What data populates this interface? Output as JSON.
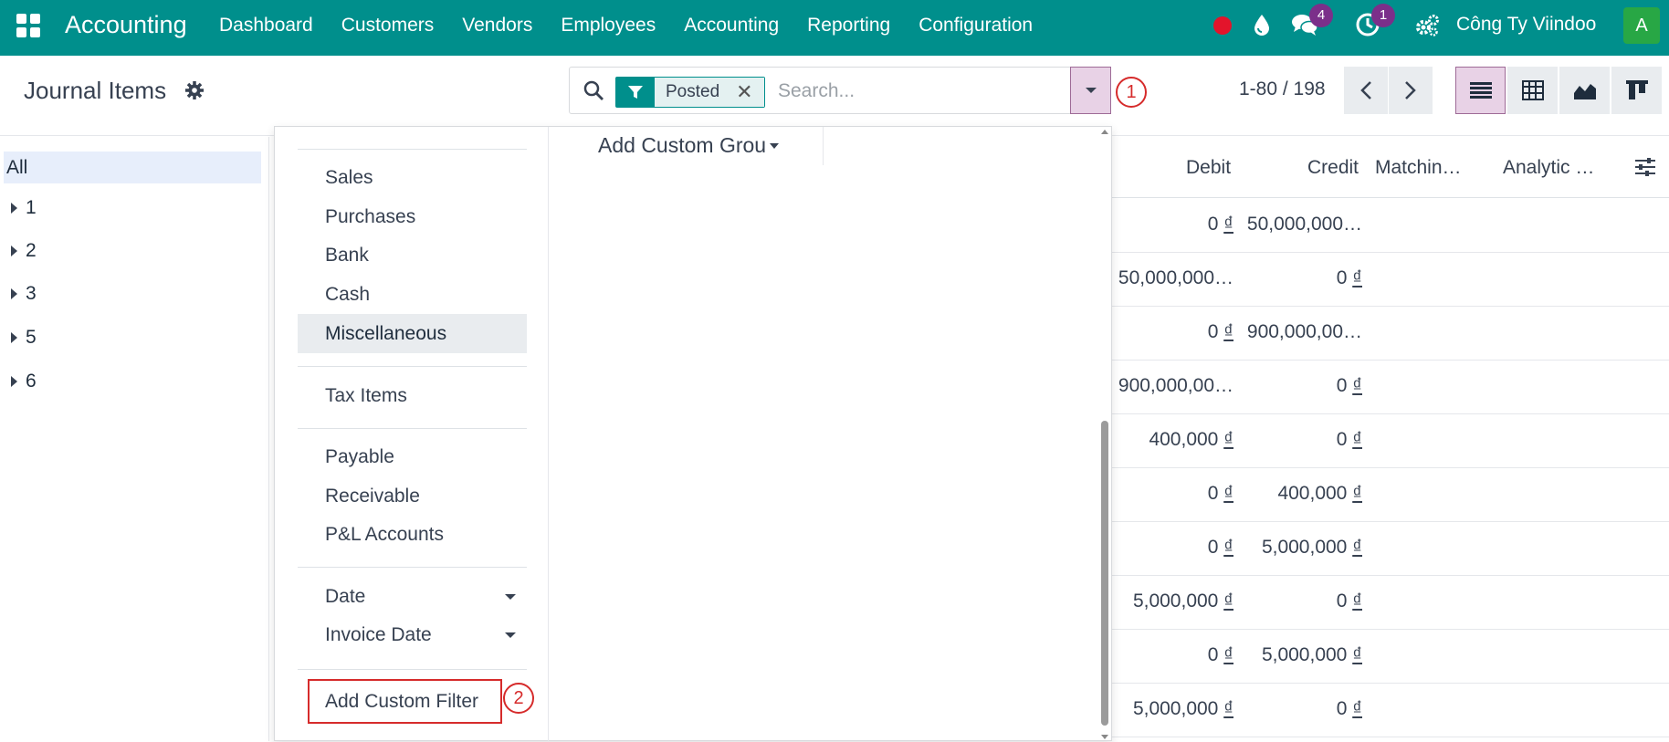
{
  "navbar": {
    "app_name": "Accounting",
    "menu": [
      "Dashboard",
      "Customers",
      "Vendors",
      "Employees",
      "Accounting",
      "Reporting",
      "Configuration"
    ],
    "messages_count": "4",
    "activities_count": "1",
    "company": "Công Ty Viindoo",
    "avatar_initial": "A",
    "colors": {
      "navbar_bg": "#008f8c",
      "badge": "#7b2f8a",
      "avatar": "#28a745",
      "record_dot": "#e3142b"
    }
  },
  "control_panel": {
    "title": "Journal Items",
    "search": {
      "facet_label": "Posted",
      "placeholder": "Search..."
    },
    "pager": "1-80 / 198",
    "callouts": {
      "toggle": "1",
      "add_filter": "2"
    }
  },
  "side_panel": {
    "all_label": "All",
    "items": [
      "1",
      "2",
      "3",
      "5",
      "6"
    ]
  },
  "filter_menu": {
    "journal_filters": [
      "Sales",
      "Purchases",
      "Bank",
      "Cash",
      "Miscellaneous"
    ],
    "active": "Miscellaneous",
    "tax_filters": [
      "Tax Items"
    ],
    "account_filters": [
      "Payable",
      "Receivable",
      "P&L Accounts"
    ],
    "date_filters": [
      "Date",
      "Invoice Date"
    ],
    "add_custom_filter": "Add Custom Filter"
  },
  "group_menu": {
    "add_custom_group": "Add Custom Grou"
  },
  "list": {
    "columns": [
      "Debit",
      "Credit",
      "Matchin…",
      "Analytic …"
    ],
    "rows": [
      {
        "debit": "0",
        "credit": "50,000,000…"
      },
      {
        "debit": "50,000,000…",
        "credit": "0"
      },
      {
        "debit": "0",
        "credit": "900,000,00…"
      },
      {
        "debit": "900,000,00…",
        "credit": "0"
      },
      {
        "debit": "400,000",
        "credit": "0"
      },
      {
        "debit": "0",
        "credit": "400,000"
      },
      {
        "debit": "0",
        "credit": "5,000,000"
      },
      {
        "debit": "5,000,000",
        "credit": "0"
      },
      {
        "debit": "0",
        "credit": "5,000,000"
      },
      {
        "debit": "5,000,000",
        "credit": "0"
      }
    ],
    "currency_symbol": "₫"
  }
}
